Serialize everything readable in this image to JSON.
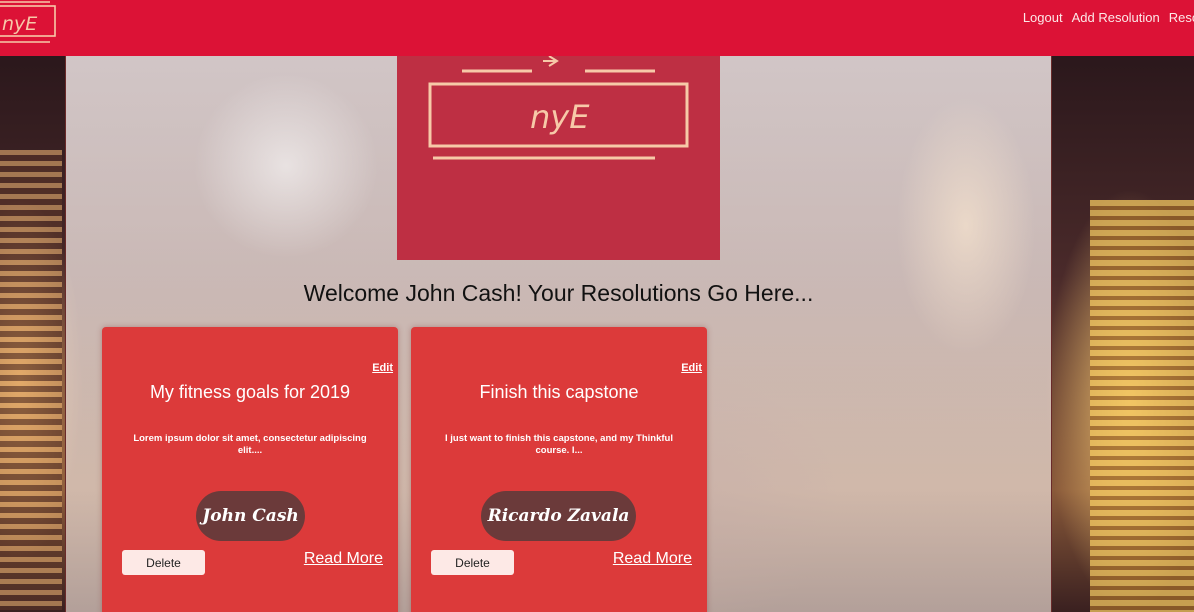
{
  "navbar": {
    "logo_text": "nyE",
    "links": [
      "Logout",
      "Add Resolution",
      "Resol"
    ]
  },
  "hero": {
    "logo_text": "nyE"
  },
  "welcome": "Welcome John Cash! Your Resolutions Go Here...",
  "cards": [
    {
      "edit_label": "Edit",
      "title": "My fitness goals for 2019",
      "description": "Lorem ipsum dolor sit amet, consectetur adipiscing elit....",
      "author": "John Cash",
      "delete_label": "Delete",
      "read_more_label": "Read More"
    },
    {
      "edit_label": "Edit",
      "title": "Finish this capstone",
      "description": "I just want to finish this capstone, and my Thinkful course. I...",
      "author": "Ricardo Zavala",
      "delete_label": "Delete",
      "read_more_label": "Read More"
    }
  ],
  "colors": {
    "navbar": "#dc1236",
    "logo_box": "#be2f43",
    "logo_line": "#f7c9a8",
    "card": "#dc3a3a",
    "author_pill": "#6b3a3a"
  }
}
